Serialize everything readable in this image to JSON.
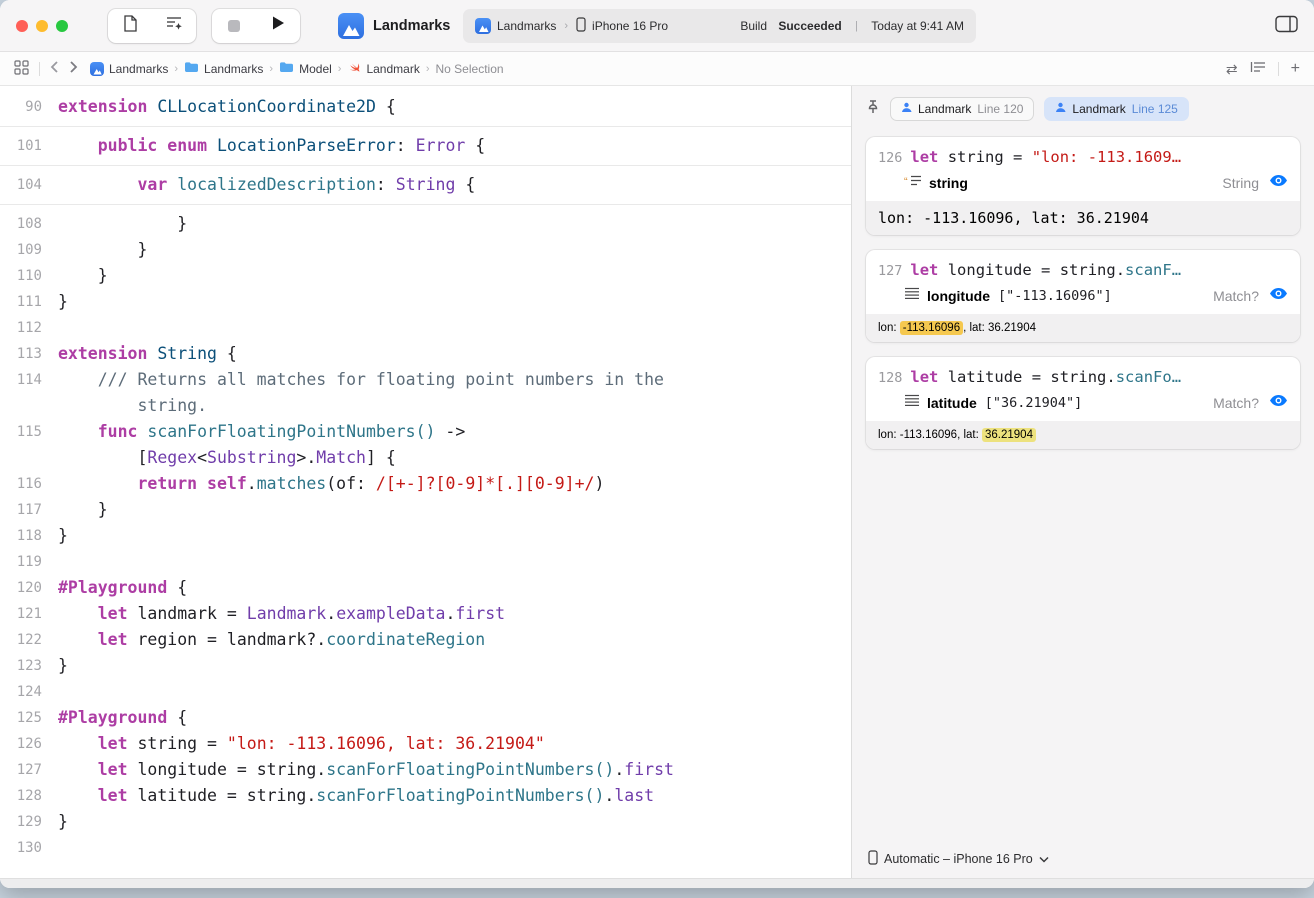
{
  "colors": {
    "accent_blue": "#0a7aff",
    "traffic_red": "#ff5f57",
    "traffic_yellow": "#febc2e",
    "traffic_green": "#28c840",
    "keyword_pink": "#ad3da4",
    "string_red": "#c41a16",
    "teal": "#2e7589",
    "purple": "#703daa",
    "navy": "#0b4f79",
    "comment_gray": "#5d6c79",
    "selected_tab_blue": "#d7e4f9"
  },
  "toolbar": {
    "project": "Landmarks",
    "status": {
      "scheme": "Landmarks",
      "chevron": "›",
      "destination": "iPhone 16 Pro",
      "build_label": "Build",
      "build_result": "Succeeded",
      "separator": "|",
      "build_time": "Today at 9:41 AM"
    }
  },
  "jumpbar": {
    "separator": "›",
    "items": [
      {
        "label": "Landmarks",
        "icon": "app-icon"
      },
      {
        "label": "Landmarks",
        "icon": "folder-icon"
      },
      {
        "label": "Model",
        "icon": "folder-icon"
      },
      {
        "label": "Landmark",
        "icon": "swift-icon"
      },
      {
        "label": "No Selection",
        "icon": ""
      }
    ],
    "right_icons": {
      "counterpart_arrows": "⇄",
      "plus": "+"
    }
  },
  "editor": {
    "rows": [
      {
        "num": "90",
        "indent": 0,
        "seg": [
          [
            "extension ",
            "kw"
          ],
          [
            "CLLocationCoordinate2D",
            "navy"
          ],
          [
            " {",
            "plain"
          ]
        ]
      },
      {
        "sep": true
      },
      {
        "num": "101",
        "indent": 4,
        "seg": [
          [
            "public enum ",
            "kw"
          ],
          [
            "LocationParseError",
            "navy"
          ],
          [
            ": ",
            "plain"
          ],
          [
            "Error",
            "purple"
          ],
          [
            " {",
            "plain"
          ]
        ]
      },
      {
        "sep": true
      },
      {
        "num": "104",
        "indent": 8,
        "seg": [
          [
            "var ",
            "kw"
          ],
          [
            "localizedDescription",
            "teal"
          ],
          [
            ": ",
            "plain"
          ],
          [
            "String",
            "purple"
          ],
          [
            " {",
            "plain"
          ]
        ]
      },
      {
        "sep": true
      },
      {
        "num": "108",
        "indent": 12,
        "seg": [
          [
            "}",
            "plain"
          ]
        ]
      },
      {
        "num": "109",
        "indent": 8,
        "seg": [
          [
            "}",
            "plain"
          ]
        ]
      },
      {
        "num": "110",
        "indent": 4,
        "seg": [
          [
            "}",
            "plain"
          ]
        ]
      },
      {
        "num": "111",
        "indent": 0,
        "seg": [
          [
            "}",
            "plain"
          ]
        ]
      },
      {
        "num": "112",
        "indent": 0,
        "seg": []
      },
      {
        "num": "113",
        "indent": 0,
        "seg": [
          [
            "extension ",
            "kw"
          ],
          [
            "String",
            "navy"
          ],
          [
            " {",
            "plain"
          ]
        ]
      },
      {
        "num": "114",
        "indent": 4,
        "seg": [
          [
            "/// Returns all matches for floating point numbers in the",
            "cmt"
          ]
        ]
      },
      {
        "num": "",
        "indent": 8,
        "seg": [
          [
            "string.",
            "cmt"
          ]
        ]
      },
      {
        "num": "115",
        "indent": 4,
        "seg": [
          [
            "func ",
            "kw"
          ],
          [
            "scanForFloatingPointNumbers()",
            "teal"
          ],
          [
            " ->",
            "plain"
          ]
        ]
      },
      {
        "num": "",
        "indent": 8,
        "seg": [
          [
            "[",
            "plain"
          ],
          [
            "Regex",
            "purple"
          ],
          [
            "<",
            "plain"
          ],
          [
            "Substring",
            "purple"
          ],
          [
            ">.",
            "plain"
          ],
          [
            "Match",
            "purple"
          ],
          [
            "] {",
            "plain"
          ]
        ]
      },
      {
        "num": "116",
        "indent": 8,
        "seg": [
          [
            "return ",
            "kw"
          ],
          [
            "self",
            "kw"
          ],
          [
            ".",
            "plain"
          ],
          [
            "matches",
            "teal"
          ],
          [
            "(of: ",
            "plain"
          ],
          [
            "/[+-]?[0-9]*[.][0-9]+/",
            "str"
          ],
          [
            ")",
            "plain"
          ]
        ]
      },
      {
        "num": "117",
        "indent": 4,
        "seg": [
          [
            "}",
            "plain"
          ]
        ]
      },
      {
        "num": "118",
        "indent": 0,
        "seg": [
          [
            "}",
            "plain"
          ]
        ]
      },
      {
        "num": "119",
        "indent": 0,
        "seg": []
      },
      {
        "num": "120",
        "indent": 0,
        "seg": [
          [
            "#Playground",
            "kw"
          ],
          [
            " {",
            "plain"
          ]
        ]
      },
      {
        "num": "121",
        "indent": 4,
        "seg": [
          [
            "let ",
            "kw"
          ],
          [
            "landmark = ",
            "plain"
          ],
          [
            "Landmark",
            "purple"
          ],
          [
            ".",
            "plain"
          ],
          [
            "exampleData",
            "purple"
          ],
          [
            ".",
            "plain"
          ],
          [
            "first",
            "purple"
          ]
        ]
      },
      {
        "num": "122",
        "indent": 4,
        "seg": [
          [
            "let ",
            "kw"
          ],
          [
            "region = landmark?.",
            "plain"
          ],
          [
            "coordinateRegion",
            "teal"
          ]
        ]
      },
      {
        "num": "123",
        "indent": 0,
        "seg": [
          [
            "}",
            "plain"
          ]
        ]
      },
      {
        "num": "124",
        "indent": 0,
        "seg": []
      },
      {
        "num": "125",
        "indent": 0,
        "seg": [
          [
            "#Playground",
            "kw"
          ],
          [
            " {",
            "plain"
          ]
        ]
      },
      {
        "num": "126",
        "indent": 4,
        "seg": [
          [
            "let ",
            "kw"
          ],
          [
            "string = ",
            "plain"
          ],
          [
            "\"lon: -113.16096, lat: 36.21904\"",
            "str"
          ]
        ]
      },
      {
        "num": "127",
        "indent": 4,
        "seg": [
          [
            "let ",
            "kw"
          ],
          [
            "longitude = string.",
            "plain"
          ],
          [
            "scanForFloatingPointNumbers()",
            "teal"
          ],
          [
            ".",
            "plain"
          ],
          [
            "first",
            "purple"
          ]
        ]
      },
      {
        "num": "128",
        "indent": 4,
        "seg": [
          [
            "let ",
            "kw"
          ],
          [
            "latitude = string.",
            "plain"
          ],
          [
            "scanForFloatingPointNumbers()",
            "teal"
          ],
          [
            ".",
            "plain"
          ],
          [
            "last",
            "purple"
          ]
        ]
      },
      {
        "num": "129",
        "indent": 0,
        "seg": [
          [
            "}",
            "plain"
          ]
        ]
      },
      {
        "num": "130",
        "indent": 0,
        "seg": []
      }
    ]
  },
  "results": {
    "tabs": [
      {
        "label": "Landmark",
        "line": "Line 120",
        "selected": false
      },
      {
        "label": "Landmark",
        "line": "Line 125",
        "selected": true
      }
    ],
    "cards": [
      {
        "line": "126",
        "code_kw": "let",
        "code_mid": " string = ",
        "code_str": "\"lon: -113.1609…",
        "name": "string",
        "type": "String",
        "value": "lon: -113.16096, lat: 36.21904"
      },
      {
        "line": "127",
        "code_kw": "let",
        "code_mid": " longitude = string.",
        "code_fn": "scanF…",
        "name": "longitude",
        "detail": "[\"-113.16096\"]",
        "type": "Match?",
        "value_pre": "lon: ",
        "value_hl": "-113.16096",
        "value_post": ", lat: 36.21904",
        "hl_color": "#f5c84f"
      },
      {
        "line": "128",
        "code_kw": "let",
        "code_mid": " latitude = string.",
        "code_fn": "scanFo…",
        "name": "latitude",
        "detail": "[\"36.21904\"]",
        "type": "Match?",
        "value_pre": "lon: -113.16096, lat: ",
        "value_hl": "36.21904",
        "value_post": "",
        "hl_color": "#ede27e"
      },
      null
    ],
    "device_bar": {
      "label": "Automatic – iPhone 16 Pro"
    }
  }
}
